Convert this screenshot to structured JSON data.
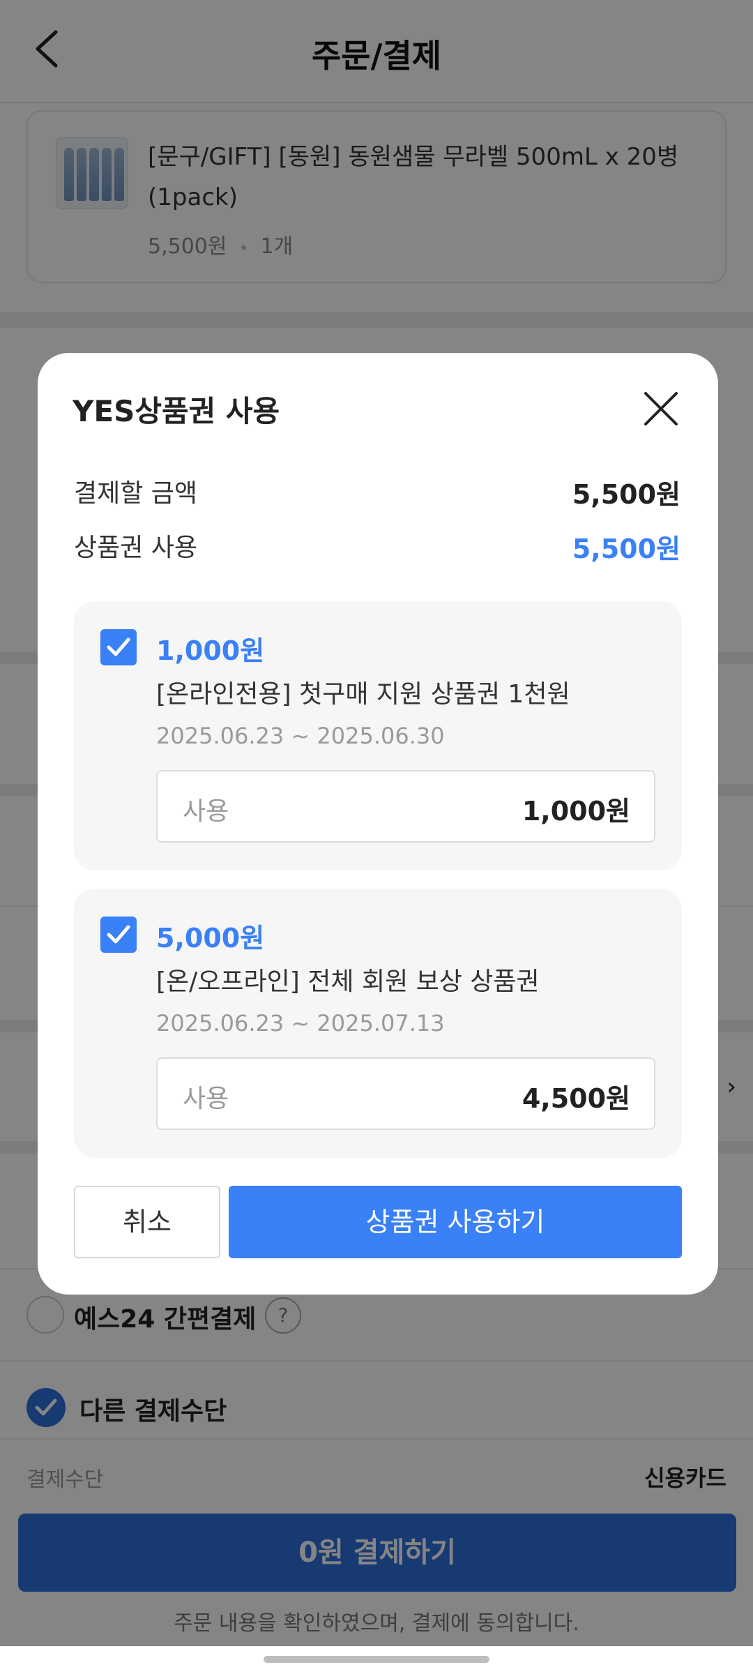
{
  "header": {
    "title": "주문/결제",
    "back_icon": "chevron-left-icon"
  },
  "product": {
    "name": "[문구/GIFT] [동원] 동원샘물 무라벨 500mL x 20병 (1pack)",
    "price": "5,500원",
    "sep": "•",
    "quantity": "1개"
  },
  "payment": {
    "yes24_easy_pay": "예스24 간편결제",
    "help_glyph": "?",
    "other_methods": "다른 결제수단",
    "method_label": "결제수단",
    "method_value": "신용카드",
    "pay_button": "0원 결제하기",
    "consent": "주문 내용을 확인하였으며, 결제에 동의합니다."
  },
  "modal": {
    "title": "YES상품권 사용",
    "summary": [
      {
        "label": "결제할 금액",
        "value": "5,500원",
        "color": "#222222"
      },
      {
        "label": "상품권 사용",
        "value": "5,500원",
        "color": "#3a80f6"
      }
    ],
    "vouchers": [
      {
        "checked": true,
        "amount": "1,000원",
        "name": "[온라인전용] 첫구매 지원 상품권 1천원",
        "period": "2025.06.23 ~ 2025.06.30",
        "use_label": "사용",
        "use_value": "1,000원"
      },
      {
        "checked": true,
        "amount": "5,000원",
        "name": "[온/오프라인] 전체 회원 보상 상품권",
        "period": "2025.06.23 ~ 2025.07.13",
        "use_label": "사용",
        "use_value": "4,500원"
      }
    ],
    "cancel_label": "취소",
    "apply_label": "상품권 사용하기"
  },
  "colors": {
    "accent": "#3a80f6",
    "primary_button": "#2f6fdc",
    "overlay": "rgba(0,0,0,0.48)"
  }
}
